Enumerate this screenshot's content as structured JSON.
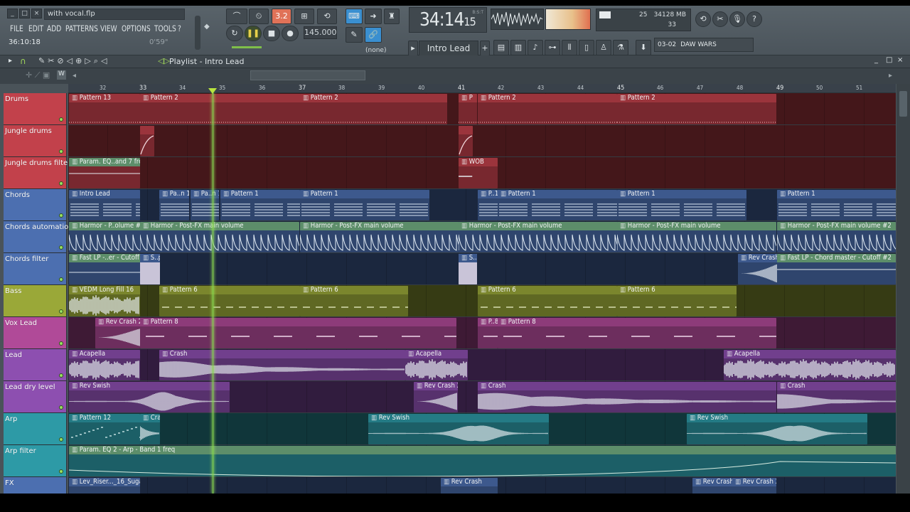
{
  "window": {
    "title": "with vocal.flp",
    "hint": "36:10:18",
    "hint_right": "0'59\""
  },
  "menu": [
    "FILE",
    "EDIT",
    "ADD",
    "PATTERNS",
    "VIEW",
    "OPTIONS",
    "TOOLS",
    "?"
  ],
  "transport": {
    "bpm": "145.000",
    "time_main": "34:14",
    "time_sub": "15",
    "time_label": "B:S:T",
    "pattern_mode": "3.2",
    "channel_select": "(none)",
    "current_pattern": "Intro Lead"
  },
  "status": {
    "cpu": "25",
    "memory": "34128 MB",
    "polyphony": "33"
  },
  "news": {
    "date": "03-02",
    "text": "DAW WARS"
  },
  "playlist": {
    "title": "Playlist - Intro Lead"
  },
  "ruler": {
    "bars": [
      "32",
      "33",
      "34",
      "35",
      "36",
      "37",
      "38",
      "39",
      "40",
      "41",
      "42",
      "43",
      "44",
      "45",
      "46",
      "47",
      "48",
      "49",
      "50",
      "51"
    ]
  },
  "tracks": [
    {
      "name": "Drums",
      "color": "#c2414b"
    },
    {
      "name": "Jungle drums",
      "color": "#c2414b"
    },
    {
      "name": "Jungle drums filter",
      "color": "#c2414b"
    },
    {
      "name": "Chords",
      "color": "#4c6fb0"
    },
    {
      "name": "Chords automation",
      "color": "#4c6fb0"
    },
    {
      "name": "Chords filter",
      "color": "#4c6fb0"
    },
    {
      "name": "Bass",
      "color": "#9aa838"
    },
    {
      "name": "Vox Lead",
      "color": "#b04a98"
    },
    {
      "name": "Lead",
      "color": "#8d4fb0"
    },
    {
      "name": "Lead dry level",
      "color": "#8d4fb0"
    },
    {
      "name": "Arp",
      "color": "#2d9aa6"
    },
    {
      "name": "Arp filter",
      "color": "#2d9aa6"
    },
    {
      "name": "FX",
      "color": "#4c6fb0"
    }
  ],
  "clips": [
    [
      {
        "label": "Pattern 13"
      },
      {
        "label": "Pattern 2"
      },
      {
        "label": "Pattern 2"
      },
      {
        "label": "P"
      },
      {
        "label": "Pattern 2"
      },
      {
        "label": "Pattern 2"
      }
    ],
    [
      {
        "label": ""
      },
      {
        "label": ""
      }
    ],
    [
      {
        "label": "Param. EQ..and 7 freq"
      },
      {
        "label": "WOB"
      }
    ],
    [
      {
        "label": "Intro Lead"
      },
      {
        "label": "Pa..n 1"
      },
      {
        "label": "Pa..n 1"
      },
      {
        "label": "Pattern 1"
      },
      {
        "label": "Pattern 1"
      },
      {
        "label": "P..1"
      },
      {
        "label": "Pattern 1"
      },
      {
        "label": "Pattern 1"
      },
      {
        "label": "Pattern 1"
      }
    ],
    [
      {
        "label": "Harmor - P..olume #2"
      },
      {
        "label": "Harmor - Post-FX main volume"
      },
      {
        "label": "Harmor - Post-FX main volume"
      },
      {
        "label": "Harmor - Post-FX main volume"
      },
      {
        "label": "Harmor - Post-FX main volume"
      },
      {
        "label": "Harmor - Post-FX main volume #2"
      }
    ],
    [
      {
        "label": "Fast LP -..er - Cutoff"
      },
      {
        "label": "S..p"
      },
      {
        "label": "S..p"
      },
      {
        "label": "Rev Crash"
      },
      {
        "label": "Fast LP - Chord master - Cutoff #2"
      }
    ],
    [
      {
        "label": "VEDM Long Fill 16"
      },
      {
        "label": "Pattern 6"
      },
      {
        "label": "Pattern 6"
      },
      {
        "label": "Pattern 6"
      },
      {
        "label": "Pattern 6"
      }
    ],
    [
      {
        "label": "Rev Crash 2"
      },
      {
        "label": "Pattern 8"
      },
      {
        "label": "P..8"
      },
      {
        "label": "Pattern 8"
      }
    ],
    [
      {
        "label": "Acapella"
      },
      {
        "label": "Crash"
      },
      {
        "label": "Acapella"
      },
      {
        "label": "Acapella"
      }
    ],
    [
      {
        "label": "Rev Swish"
      },
      {
        "label": "Rev Crash 2"
      },
      {
        "label": "Crash"
      },
      {
        "label": "Crash"
      }
    ],
    [
      {
        "label": "Pattern 12"
      },
      {
        "label": "Crash"
      },
      {
        "label": "Rev Swish"
      },
      {
        "label": "Rev Swish"
      }
    ],
    [
      {
        "label": "Param. EQ 2 - Arp - Band 1 freq"
      }
    ],
    [
      {
        "label": "Lev_Riser..._16_Sugar"
      },
      {
        "label": "Rev Crash"
      },
      {
        "label": "Rev Crash"
      },
      {
        "label": "Rev Crash 2"
      }
    ]
  ]
}
